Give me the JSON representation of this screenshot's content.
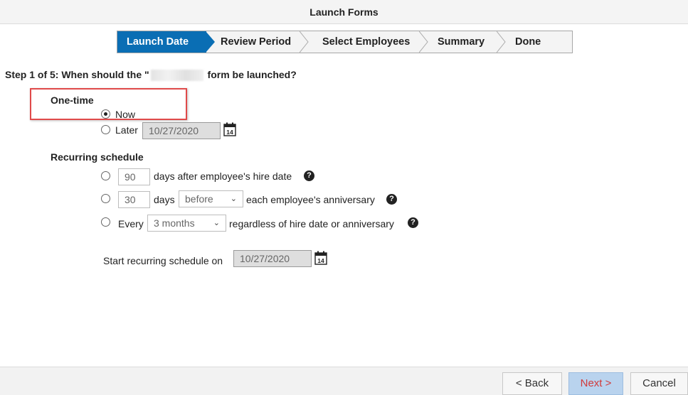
{
  "window": {
    "title": "Launch Forms"
  },
  "wizard": {
    "steps": [
      {
        "label": "Launch Date",
        "active": true
      },
      {
        "label": "Review Period",
        "active": false
      },
      {
        "label": "Select Employees",
        "active": false
      },
      {
        "label": "Summary",
        "active": false
      },
      {
        "label": "Done",
        "active": false
      }
    ]
  },
  "question": {
    "prefix": "Step 1 of 5: When should the \"",
    "suffix": "form be launched?"
  },
  "one_time": {
    "title": "One-time",
    "now_label": "Now",
    "later_label": "Later",
    "later_date": "10/27/2020",
    "selected": "now"
  },
  "recurring": {
    "title": "Recurring schedule",
    "opt1": {
      "value": "90",
      "text": "days after employee's hire date"
    },
    "opt2": {
      "value": "30",
      "days_label": "days",
      "select_value": "before",
      "text": "each employee's anniversary"
    },
    "opt3": {
      "every_label": "Every",
      "select_value": "3 months",
      "text": "regardless of hire date or anniversary"
    },
    "start_label": "Start recurring schedule on",
    "start_date": "10/27/2020"
  },
  "footer": {
    "back_label": "< Back",
    "next_label": "Next >",
    "cancel_label": "Cancel"
  },
  "colors": {
    "active_step": "#0a6eb4",
    "highlight": "#e04a4a",
    "next_text": "#d13b3b"
  },
  "icons": {
    "calendar": "calendar-icon",
    "help": "help-icon",
    "chevron": "chevron-down-icon"
  }
}
